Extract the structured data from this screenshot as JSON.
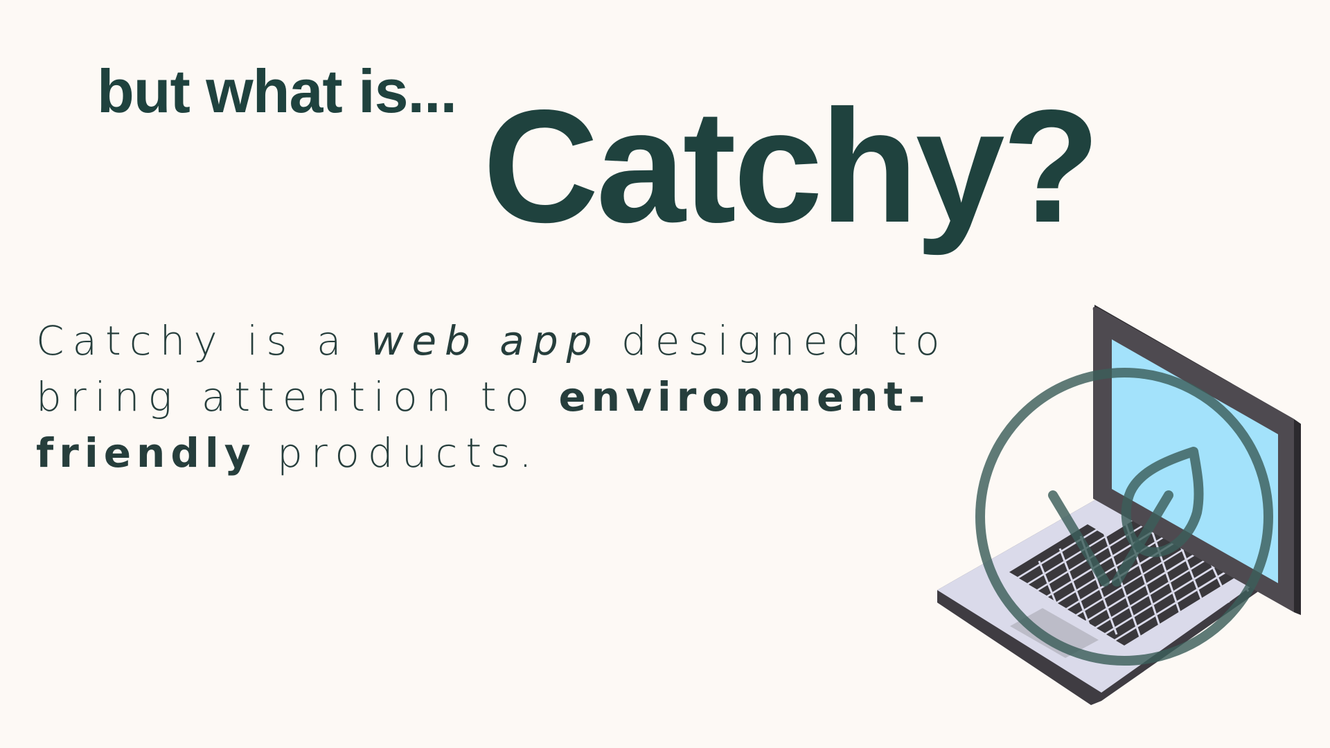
{
  "slide": {
    "kicker": "but what is...",
    "headline": "Catchy?",
    "description": {
      "part1": "Catchy is a ",
      "emphasis": "web app",
      "part2": " designed to bring attention to ",
      "strong": "environment-friendly",
      "part3": " products."
    }
  },
  "illustration": {
    "icons": [
      "laptop-icon",
      "leaf-icon"
    ]
  },
  "colors": {
    "background": "#fdf9f5",
    "text": "#1f423e",
    "screen": "#a3e2fb",
    "laptop_frame": "#4e4a50",
    "laptop_base": "#dadaea",
    "keys": "#3a383c",
    "overlay_stroke": "#3c5e5a"
  }
}
